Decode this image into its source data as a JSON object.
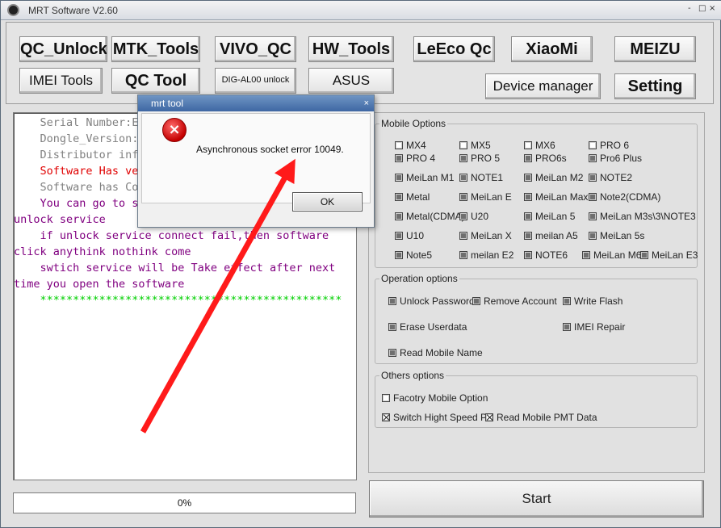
{
  "window": {
    "title": "MRT Software V2.60",
    "controls": [
      "-",
      "□",
      "×"
    ]
  },
  "toolbar": {
    "qc_unlock": "QC_Unlock",
    "mtk_tools": "MTK_Tools",
    "vivo_qc": "VIVO_QC",
    "hw_tools": "HW_Tools",
    "leeco_qc": "LeEco Qc",
    "xiaomi": "XiaoMi",
    "meizu": "MEIZU",
    "imei_tools": "IMEI Tools",
    "qc_tool": "QC Tool",
    "dig_al00": "DIG-AL00 unlock",
    "asus": "ASUS",
    "device_manager": "Device manager",
    "setting": "Setting"
  },
  "log": {
    "lines": [
      {
        "text": "    Serial Number:E",
        "color": "#808080"
      },
      {
        "text": "    Dongle_Version:",
        "color": "#808080"
      },
      {
        "text": "    Distributor inf",
        "color": "#808080"
      },
      {
        "text": "    Software Has ve",
        "color": "#e00000"
      },
      {
        "text": "    Software has Co",
        "color": "#808080"
      },
      {
        "text": "    You can go to s",
        "color": "#800080"
      },
      {
        "text": "unlock service",
        "color": "#800080"
      },
      {
        "text": "    if unlock service connect fail,then software",
        "color": "#800080"
      },
      {
        "text": "click anythink nothink come",
        "color": "#800080"
      },
      {
        "text": "    swtich service will be Take effect after next",
        "color": "#800080"
      },
      {
        "text": "time you open the software",
        "color": "#800080"
      },
      {
        "text": "    **********************************************",
        "color": "#00d000"
      }
    ]
  },
  "progress": {
    "label": "0%",
    "value": 0
  },
  "mobile_options": {
    "title": "Mobile Options",
    "items": [
      "MX4",
      "MX5",
      "MX6",
      "PRO 6",
      "PRO 4",
      "PRO 5",
      "PRO6s",
      "Pro6 Plus",
      "MeiLan M1",
      "NOTE1",
      "MeiLan M2",
      "NOTE2",
      "Metal",
      "MeiLan E",
      "MeiLan Max",
      "Note2(CDMA)",
      "Metal(CDMA)",
      "U20",
      "MeiLan 5",
      "MeiLan M3s\\3\\NOTE3",
      "U10",
      "MeiLan X",
      "meilan A5",
      "MeiLan 5s",
      "Note5",
      "meilan E2",
      "NOTE6",
      "MeiLan M6",
      "MeiLan E3"
    ]
  },
  "operation_options": {
    "title": "Operation options",
    "unlock_password": "Unlock Password",
    "remove_account": "Remove Account",
    "write_flash": "Write Flash",
    "erase_userdata": "Erase Userdata",
    "imei_repair": "IMEI Repair",
    "read_mobile_name": "Read Mobile Name"
  },
  "others_options": {
    "title": "Others options",
    "factory_mobile": "Facotry Mobile Option",
    "switch_high_speed": "Switch Hight Speed Por",
    "read_mobile_pmt": "Read Mobile PMT Data"
  },
  "start": {
    "label": "Start"
  },
  "dialog": {
    "title": "mrt tool",
    "close": "×",
    "message": "Asynchronous socket error 10049.",
    "ok": "OK",
    "icon": "×"
  },
  "colors": {
    "arrow": "#ff1a1a",
    "dialog_title": "#4a73ad"
  }
}
